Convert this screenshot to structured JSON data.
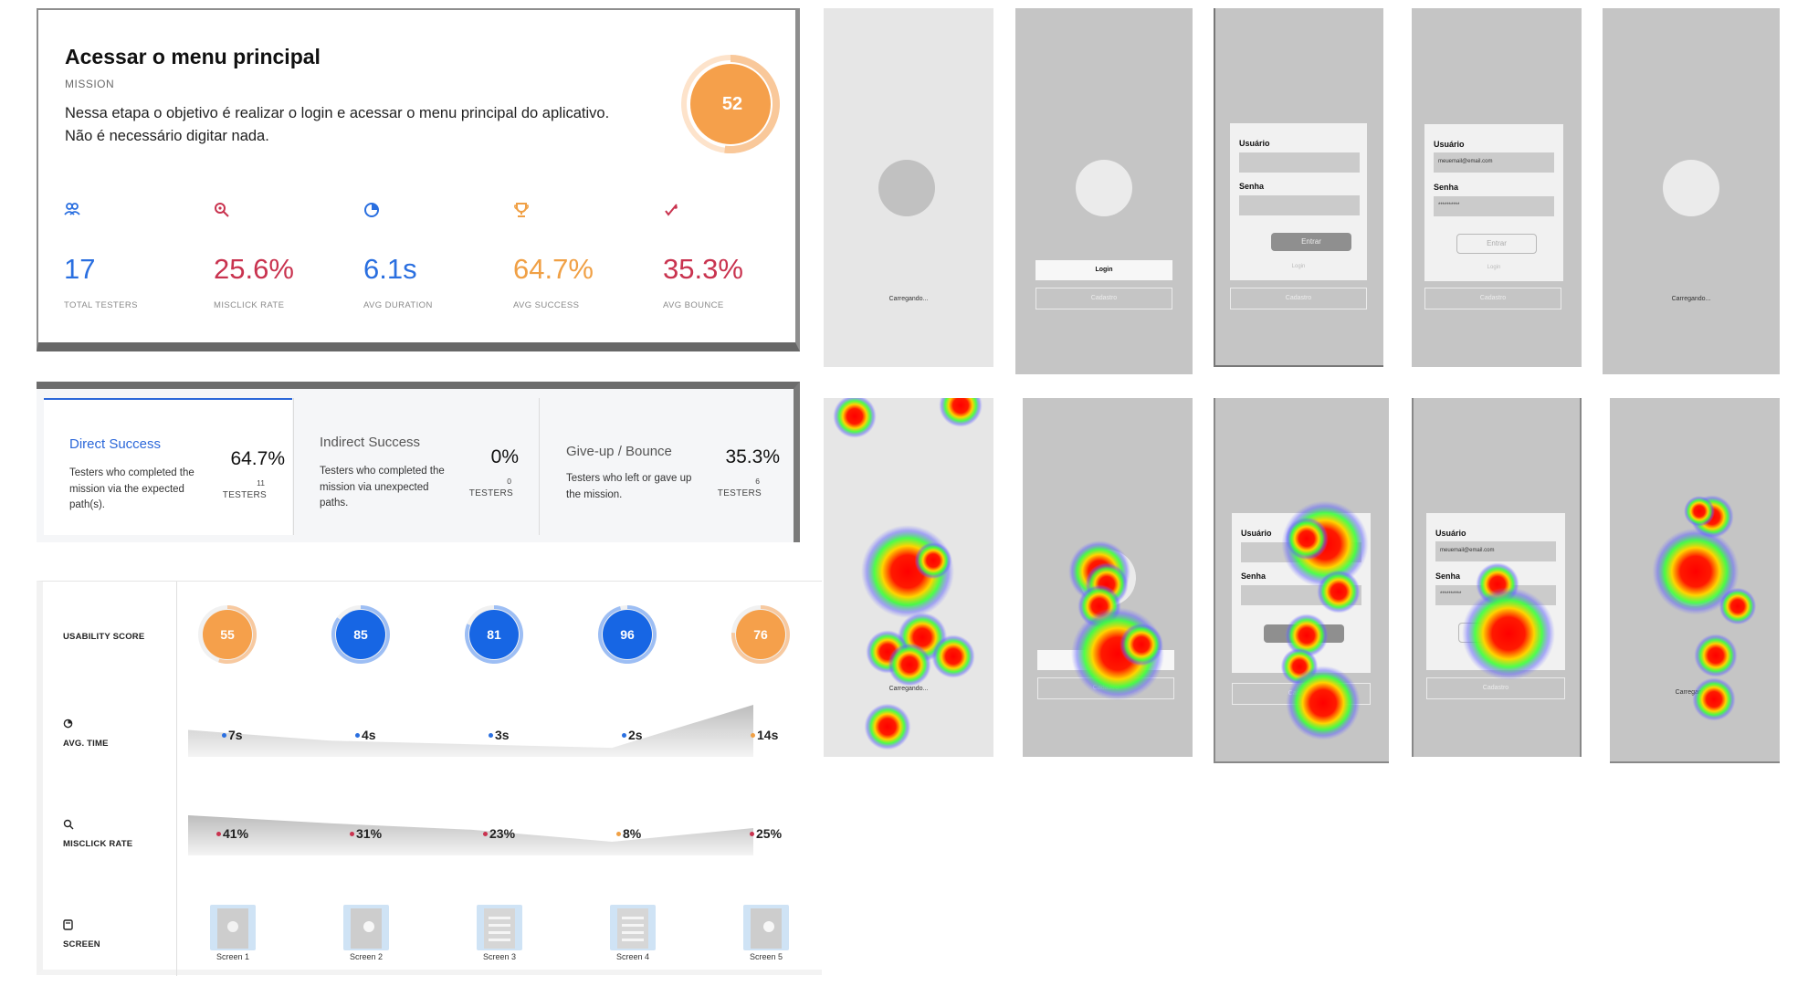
{
  "mission": {
    "title": "Acessar o menu principal",
    "subtitle": "MISSION",
    "description_line1": "Nessa etapa o objetivo é realizar o login e acessar o menu principal do aplicativo.",
    "description_line2": "Não é necessário digitar nada.",
    "score": "52",
    "score_fraction": 0.52,
    "score_color": "#f5a04b",
    "stats": [
      {
        "icon": "users-icon",
        "value": "17",
        "label": "TOTAL TESTERS",
        "color": "#2a6fe0"
      },
      {
        "icon": "misclick-icon",
        "value": "25.6%",
        "label": "MISCLICK RATE",
        "color": "#c9334f"
      },
      {
        "icon": "clock-icon",
        "value": "6.1s",
        "label": "AVG DURATION",
        "color": "#2a6fe0"
      },
      {
        "icon": "trophy-icon",
        "value": "64.7%",
        "label": "AVG SUCCESS",
        "color": "#f0a045"
      },
      {
        "icon": "bounce-icon",
        "value": "35.3%",
        "label": "AVG BOUNCE",
        "color": "#c9334f"
      }
    ]
  },
  "success": {
    "direct": {
      "name": "Direct Success",
      "desc": "Testers who completed the mission via the expected path(s).",
      "pct": "64.7%",
      "count": "11",
      "unit": "TESTERS",
      "color": "#2b67d9"
    },
    "indirect": {
      "name": "Indirect Success",
      "desc": "Testers who completed the mission via unexpected paths.",
      "pct": "0%",
      "count": "0",
      "unit": "TESTERS",
      "color": "#555"
    },
    "bounce": {
      "name": "Give-up / Bounce",
      "desc": "Testers who left or gave up the mission.",
      "pct": "35.3%",
      "count": "6",
      "unit": "TESTERS",
      "color": "#555"
    }
  },
  "metrics": {
    "usability_label": "USABILITY SCORE",
    "time_label": "AVG. TIME",
    "misclick_label": "MISCLICK RATE",
    "screen_label": "SCREEN",
    "scores": [
      {
        "value": "55",
        "fraction": 0.55,
        "color": "#f5a04b",
        "ring": "#f7c9a0"
      },
      {
        "value": "85",
        "fraction": 0.85,
        "color": "#1766e4",
        "ring": "#9dbef4"
      },
      {
        "value": "81",
        "fraction": 0.81,
        "color": "#1766e4",
        "ring": "#9dbef4"
      },
      {
        "value": "96",
        "fraction": 0.96,
        "color": "#1766e4",
        "ring": "#9dbef4"
      },
      {
        "value": "76",
        "fraction": 0.76,
        "color": "#f5a04b",
        "ring": "#f7c9a0"
      }
    ],
    "times": [
      {
        "text": "7s",
        "seconds": 7,
        "dot": "#2a6fe0"
      },
      {
        "text": "4s",
        "seconds": 4,
        "dot": "#2a6fe0"
      },
      {
        "text": "3s",
        "seconds": 3,
        "dot": "#2a6fe0"
      },
      {
        "text": "2s",
        "seconds": 2,
        "dot": "#2a6fe0"
      },
      {
        "text": "14s",
        "seconds": 14,
        "dot": "#f0a045"
      }
    ],
    "misclicks": [
      {
        "text": "41%",
        "percent": 41,
        "dot": "#c9334f"
      },
      {
        "text": "31%",
        "percent": 31,
        "dot": "#c9334f"
      },
      {
        "text": "23%",
        "percent": 23,
        "dot": "#c9334f"
      },
      {
        "text": "8%",
        "percent": 8,
        "dot": "#f0a045"
      },
      {
        "text": "25%",
        "percent": 25,
        "dot": "#c9334f"
      }
    ],
    "screens": [
      "Screen 1",
      "Screen 2",
      "Screen 3",
      "Screen 4",
      "Screen 5"
    ]
  },
  "phones": {
    "loading_text": "Carregando...",
    "login_button": "Login",
    "register_button": "Cadastro",
    "user_label": "Usuário",
    "password_label": "Senha",
    "email_value": "meuemail@email.com",
    "password_value": "**********",
    "enter_button": "Entrar"
  }
}
